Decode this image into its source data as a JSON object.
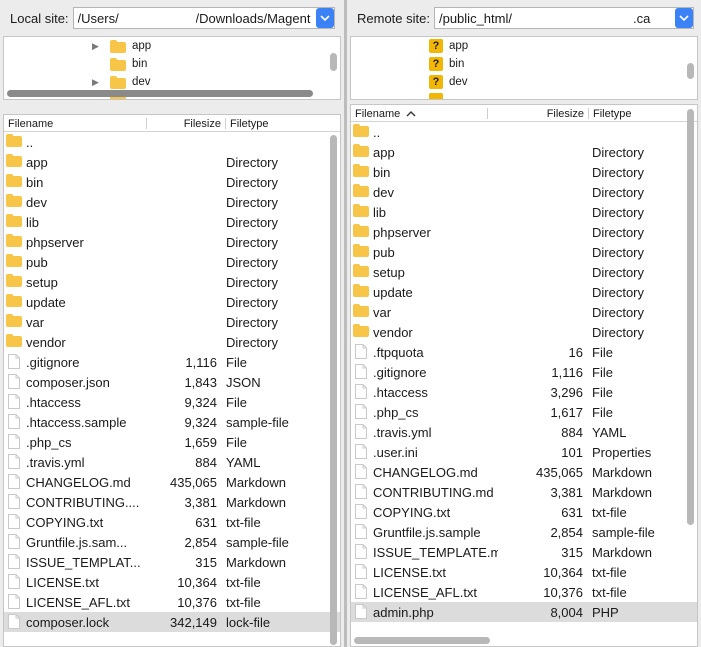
{
  "local": {
    "label": "Local site:",
    "path_left": "/Users/",
    "path_right": "/Downloads/Magent",
    "tree": [
      {
        "name": "app",
        "expandable": true
      },
      {
        "name": "bin",
        "expandable": false
      },
      {
        "name": "dev",
        "expandable": true
      }
    ],
    "columns": {
      "filename": "Filename",
      "filesize": "Filesize",
      "filetype": "Filetype"
    },
    "files": [
      {
        "name": "..",
        "size": "",
        "type": "",
        "kind": "folder"
      },
      {
        "name": "app",
        "size": "",
        "type": "Directory",
        "kind": "folder"
      },
      {
        "name": "bin",
        "size": "",
        "type": "Directory",
        "kind": "folder"
      },
      {
        "name": "dev",
        "size": "",
        "type": "Directory",
        "kind": "folder"
      },
      {
        "name": "lib",
        "size": "",
        "type": "Directory",
        "kind": "folder"
      },
      {
        "name": "phpserver",
        "size": "",
        "type": "Directory",
        "kind": "folder"
      },
      {
        "name": "pub",
        "size": "",
        "type": "Directory",
        "kind": "folder"
      },
      {
        "name": "setup",
        "size": "",
        "type": "Directory",
        "kind": "folder"
      },
      {
        "name": "update",
        "size": "",
        "type": "Directory",
        "kind": "folder"
      },
      {
        "name": "var",
        "size": "",
        "type": "Directory",
        "kind": "folder"
      },
      {
        "name": "vendor",
        "size": "",
        "type": "Directory",
        "kind": "folder"
      },
      {
        "name": ".gitignore",
        "size": "1,116",
        "type": "File",
        "kind": "file"
      },
      {
        "name": "composer.json",
        "size": "1,843",
        "type": "JSON",
        "kind": "file"
      },
      {
        "name": ".htaccess",
        "size": "9,324",
        "type": "File",
        "kind": "file"
      },
      {
        "name": ".htaccess.sample",
        "size": "9,324",
        "type": "sample-file",
        "kind": "file"
      },
      {
        "name": ".php_cs",
        "size": "1,659",
        "type": "File",
        "kind": "file"
      },
      {
        "name": ".travis.yml",
        "size": "884",
        "type": "YAML",
        "kind": "file"
      },
      {
        "name": "CHANGELOG.md",
        "size": "435,065",
        "type": "Markdown",
        "kind": "file"
      },
      {
        "name": "CONTRIBUTING....",
        "size": "3,381",
        "type": "Markdown",
        "kind": "file"
      },
      {
        "name": "COPYING.txt",
        "size": "631",
        "type": "txt-file",
        "kind": "file"
      },
      {
        "name": "Gruntfile.js.sam...",
        "size": "2,854",
        "type": "sample-file",
        "kind": "file"
      },
      {
        "name": "ISSUE_TEMPLAT...",
        "size": "315",
        "type": "Markdown",
        "kind": "file"
      },
      {
        "name": "LICENSE.txt",
        "size": "10,364",
        "type": "txt-file",
        "kind": "file"
      },
      {
        "name": "LICENSE_AFL.txt",
        "size": "10,376",
        "type": "txt-file",
        "kind": "file"
      },
      {
        "name": "composer.lock",
        "size": "342,149",
        "type": "lock-file",
        "kind": "file",
        "selected": true
      }
    ]
  },
  "remote": {
    "label": "Remote site:",
    "path_left": "/public_html/",
    "path_right": ".ca",
    "tree": [
      {
        "name": "app"
      },
      {
        "name": "bin"
      },
      {
        "name": "dev"
      }
    ],
    "columns": {
      "filename": "Filename",
      "filesize": "Filesize",
      "filetype": "Filetype"
    },
    "files": [
      {
        "name": "..",
        "size": "",
        "type": "",
        "kind": "folder"
      },
      {
        "name": "app",
        "size": "",
        "type": "Directory",
        "kind": "folder"
      },
      {
        "name": "bin",
        "size": "",
        "type": "Directory",
        "kind": "folder"
      },
      {
        "name": "dev",
        "size": "",
        "type": "Directory",
        "kind": "folder"
      },
      {
        "name": "lib",
        "size": "",
        "type": "Directory",
        "kind": "folder"
      },
      {
        "name": "phpserver",
        "size": "",
        "type": "Directory",
        "kind": "folder"
      },
      {
        "name": "pub",
        "size": "",
        "type": "Directory",
        "kind": "folder"
      },
      {
        "name": "setup",
        "size": "",
        "type": "Directory",
        "kind": "folder"
      },
      {
        "name": "update",
        "size": "",
        "type": "Directory",
        "kind": "folder"
      },
      {
        "name": "var",
        "size": "",
        "type": "Directory",
        "kind": "folder"
      },
      {
        "name": "vendor",
        "size": "",
        "type": "Directory",
        "kind": "folder"
      },
      {
        "name": ".ftpquota",
        "size": "16",
        "type": "File",
        "kind": "file"
      },
      {
        "name": ".gitignore",
        "size": "1,116",
        "type": "File",
        "kind": "file"
      },
      {
        "name": ".htaccess",
        "size": "3,296",
        "type": "File",
        "kind": "file"
      },
      {
        "name": ".php_cs",
        "size": "1,617",
        "type": "File",
        "kind": "file"
      },
      {
        "name": ".travis.yml",
        "size": "884",
        "type": "YAML",
        "kind": "file"
      },
      {
        "name": ".user.ini",
        "size": "101",
        "type": "Properties",
        "kind": "file"
      },
      {
        "name": "CHANGELOG.md",
        "size": "435,065",
        "type": "Markdown",
        "kind": "file"
      },
      {
        "name": "CONTRIBUTING.md",
        "size": "3,381",
        "type": "Markdown",
        "kind": "file"
      },
      {
        "name": "COPYING.txt",
        "size": "631",
        "type": "txt-file",
        "kind": "file"
      },
      {
        "name": "Gruntfile.js.sample",
        "size": "2,854",
        "type": "sample-file",
        "kind": "file"
      },
      {
        "name": "ISSUE_TEMPLATE.md",
        "size": "315",
        "type": "Markdown",
        "kind": "file"
      },
      {
        "name": "LICENSE.txt",
        "size": "10,364",
        "type": "txt-file",
        "kind": "file"
      },
      {
        "name": "LICENSE_AFL.txt",
        "size": "10,376",
        "type": "txt-file",
        "kind": "file"
      },
      {
        "name": "admin.php",
        "size": "8,004",
        "type": "PHP",
        "kind": "file",
        "selected": true
      }
    ]
  },
  "colors": {
    "folder": "#f7c548",
    "selection": "#dcdcdc",
    "combo_button": "#3b82f6",
    "unknown_badge": "#f2b705"
  }
}
